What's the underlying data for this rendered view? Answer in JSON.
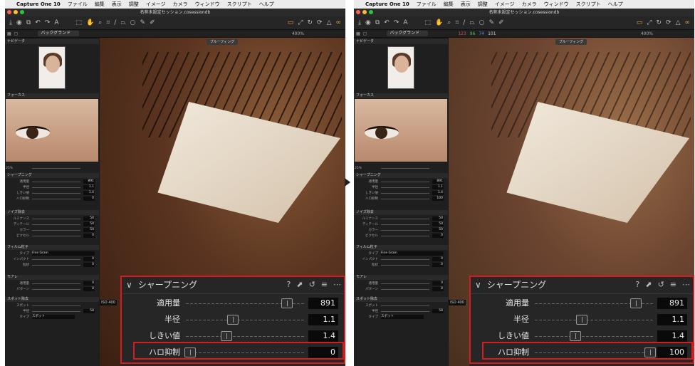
{
  "menubar": {
    "apple": "",
    "app_name": "Capture One 10",
    "items": [
      "ファイル",
      "編集",
      "表示",
      "調整",
      "イメージ",
      "カメラ",
      "ウィンドウ",
      "スクリプト",
      "ヘルプ"
    ]
  },
  "window": {
    "title": "名称未設定セッション.cosessiondb",
    "colors": {
      "close": "#fe5f57",
      "min": "#febc2e",
      "max": "#28c840"
    }
  },
  "toolbar": {
    "text_tool_glyph": "A"
  },
  "viewer_bar": {
    "preset": "バックグランド",
    "zoom": "400%",
    "rgb_right": [
      "123",
      "96",
      "74",
      "101"
    ],
    "proof_label": "プルーフィング",
    "iso": "ISO 400"
  },
  "sidebar": {
    "navigator": "ナビゲータ",
    "focus": "フォーカス",
    "focus_zoom": "25%",
    "sections": {
      "sharpening": "シャープニング",
      "noise": "ノイズ除去",
      "grain": "フィルム粒子",
      "moire": "モアレ",
      "spot": "スポット除去"
    },
    "sharpen_rows": [
      {
        "label": "適用量",
        "value": "891"
      },
      {
        "label": "半径",
        "value": "1.1"
      },
      {
        "label": "しきい値",
        "value": "1.4"
      },
      {
        "label": "ハロ抑制",
        "value": "0"
      }
    ],
    "sharpen_rows_right_halo": "100",
    "noise_rows": [
      {
        "label": "ルミナンス",
        "value": "50"
      },
      {
        "label": "ディテール",
        "value": "50"
      },
      {
        "label": "カラー",
        "value": "50"
      },
      {
        "label": "ピクセル",
        "value": "0"
      }
    ],
    "grain_rows": [
      {
        "label": "タイプ",
        "value": "Fine Grain"
      },
      {
        "label": "インパクト",
        "value": "0"
      },
      {
        "label": "粒状",
        "value": "0"
      }
    ],
    "moire_rows": [
      {
        "label": "適用量",
        "value": "0"
      },
      {
        "label": "パターン",
        "value": "8"
      }
    ],
    "spot_rows": [
      {
        "label": "スポット",
        "value": ""
      },
      {
        "label": "半径",
        "value": "58"
      },
      {
        "label": "タイプ",
        "value": "スポット"
      }
    ]
  },
  "panel": {
    "title": "シャープニング",
    "rows_left": [
      {
        "label": "適用量",
        "value": "891",
        "pos": 0.84
      },
      {
        "label": "半径",
        "value": "1.1",
        "pos": 0.36
      },
      {
        "label": "しきい値",
        "value": "1.4",
        "pos": 0.3
      },
      {
        "label": "ハロ抑制",
        "value": "0",
        "pos": 0.0
      }
    ],
    "rows_right": [
      {
        "label": "適用量",
        "value": "891",
        "pos": 0.84
      },
      {
        "label": "半径",
        "value": "1.1",
        "pos": 0.36
      },
      {
        "label": "しきい値",
        "value": "1.4",
        "pos": 0.3
      },
      {
        "label": "ハロ抑制",
        "value": "100",
        "pos": 0.92
      }
    ]
  },
  "colors": {
    "highlight": "#d61c1c",
    "accent": "#e8a84a"
  }
}
